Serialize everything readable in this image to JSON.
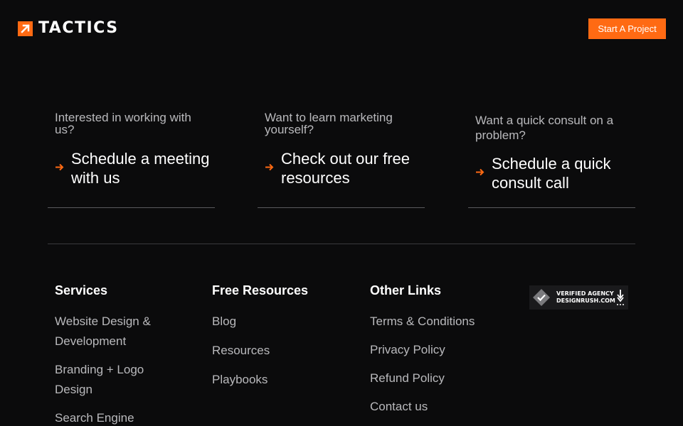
{
  "header": {
    "logo_text": "TACTICS",
    "cta_label": "Start A Project"
  },
  "cards": [
    {
      "question": "Interested in working with us?",
      "link": "Schedule a meeting with us"
    },
    {
      "question": "Want to learn marketing yourself?",
      "link": "Check out our free resources"
    },
    {
      "question": "Want a quick consult on a problem?",
      "link": "Schedule a quick consult call"
    }
  ],
  "footer": {
    "services": {
      "title": "Services",
      "items": [
        "Website Design & Development",
        "Branding + Logo Design",
        "Search Engine"
      ]
    },
    "resources": {
      "title": "Free Resources",
      "items": [
        "Blog",
        "Resources",
        "Playbooks"
      ]
    },
    "other": {
      "title": "Other Links",
      "items": [
        "Terms & Conditions",
        "Privacy Policy",
        "Refund Policy",
        "Contact us"
      ]
    },
    "badge": {
      "line1": "VERIFIED AGENCY",
      "line2": "DESIGNRUSH.COM"
    }
  },
  "colors": {
    "accent": "#ff6a13",
    "background": "#0b0b0c"
  }
}
